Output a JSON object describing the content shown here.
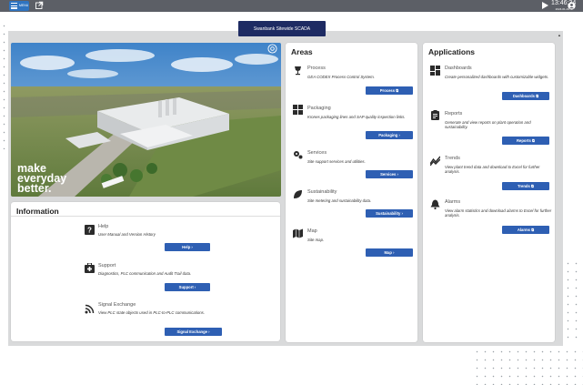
{
  "topbar": {
    "menu_label": "MENU",
    "time": "13:46:34",
    "date": "2024-01-19"
  },
  "title": "Swanbank Sitewide SCADA",
  "hero": {
    "line1": "make",
    "line2": "everyday",
    "line3": "better."
  },
  "information": {
    "title": "Information",
    "items": [
      {
        "title": "Help",
        "desc": "User Manual and Version History",
        "button": "Help"
      },
      {
        "title": "Support",
        "desc": "Diagnostics, PLC communication and Audit Trail data.",
        "button": "Support"
      },
      {
        "title": "Signal Exchange",
        "desc": "View PLC state objects used in PLC-to-PLC communications.",
        "button": "Signal Exchange"
      }
    ]
  },
  "areas": {
    "title": "Areas",
    "items": [
      {
        "title": "Process",
        "desc": "GEA CODEX Process Control System.",
        "button": "Process"
      },
      {
        "title": "Packaging",
        "desc": "Krones packaging lines and SAP quality inspection links.",
        "button": "Packaging"
      },
      {
        "title": "Services",
        "desc": "Site support services and utilities.",
        "button": "Services"
      },
      {
        "title": "Sustainability",
        "desc": "Site metering and sustainability data.",
        "button": "Sustainability"
      },
      {
        "title": "Map",
        "desc": "Site map.",
        "button": "Map"
      }
    ]
  },
  "applications": {
    "title": "Applications",
    "items": [
      {
        "title": "Dashboards",
        "desc": "Create personalized dashboards with customizable widgets.",
        "button": "Dashboards"
      },
      {
        "title": "Reports",
        "desc": "Generate and view reports on plant operation and sustainability.",
        "button": "Reports"
      },
      {
        "title": "Trends",
        "desc": "View plant trend data and download to Excel for further analysis.",
        "button": "Trends"
      },
      {
        "title": "Alarms",
        "desc": "View alarm statistics and download alarms to Excel for further analysis.",
        "button": "Alarms"
      }
    ]
  },
  "colors": {
    "topbar": "#5c5f66",
    "accent": "#2e5fb3",
    "title_badge": "#1e2b63",
    "frame": "#d9dadb"
  }
}
